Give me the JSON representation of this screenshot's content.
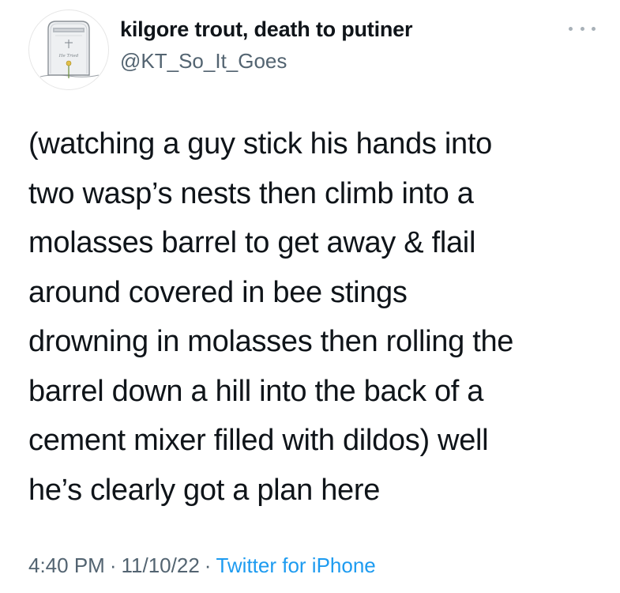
{
  "author": {
    "display_name": "kilgore trout, death to putiner",
    "handle": "@KT_So_It_Goes",
    "avatar_icon": "tombstone-icon",
    "avatar_text": "He Tried"
  },
  "tweet": {
    "lines": [
      "(watching a guy stick his hands into",
      "two wasp’s nests then climb into a",
      "molasses barrel to get away & flail",
      "around covered in bee stings",
      "drowning in molasses then rolling the",
      "barrel down a hill into the back of a",
      "cement mixer filled with dildos) well",
      "he’s clearly got a plan here"
    ]
  },
  "meta": {
    "time": "4:40 PM",
    "separator": "·",
    "date": "11/10/22",
    "source": "Twitter for iPhone"
  },
  "colors": {
    "text": "#0f1419",
    "secondary": "#536471",
    "link": "#1d9bf0"
  },
  "icons": {
    "more": "more-dots-icon"
  }
}
